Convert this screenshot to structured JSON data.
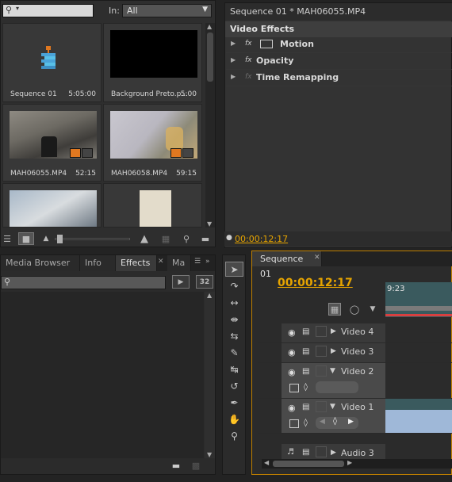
{
  "project": {
    "search_placeholder": "",
    "in_label": "In:",
    "in_value": "All",
    "items": [
      {
        "name": "Sequence 01",
        "duration": "5:05:00",
        "thumb": "sequence"
      },
      {
        "name": "Background Preto.p...",
        "duration": "5:00",
        "thumb": "black"
      },
      {
        "name": "MAH06055.MP4",
        "duration": "52:15",
        "thumb": "video"
      },
      {
        "name": "MAH06058.MP4",
        "duration": "59:15",
        "thumb": "video"
      },
      {
        "name": "",
        "duration": "",
        "thumb": "video"
      },
      {
        "name": "",
        "duration": "",
        "thumb": "paper"
      }
    ]
  },
  "effect_controls": {
    "header": "Sequence 01 * MAH06055.MP4",
    "section": "Video Effects",
    "effects": [
      {
        "label": "Motion"
      },
      {
        "label": "Opacity"
      },
      {
        "label": "Time Remapping"
      }
    ],
    "timecode": "00:00:12:17"
  },
  "effects_panel": {
    "tabs": [
      "Media Browser",
      "Info",
      "Effects",
      "Ma"
    ],
    "active_tab": "Effects",
    "btn_32": "32"
  },
  "timeline": {
    "tab": "Sequence 01",
    "timecode": "00:00:12:17",
    "ruler_label": "9:23",
    "tracks": [
      {
        "name": "Video 4"
      },
      {
        "name": "Video 3"
      },
      {
        "name": "Video 2"
      },
      {
        "name": "Video 1"
      },
      {
        "name": "Audio 3"
      }
    ]
  },
  "colors": {
    "accent": "#e6a400",
    "clip": "#9fb8d8",
    "playhead": "#d84040"
  }
}
